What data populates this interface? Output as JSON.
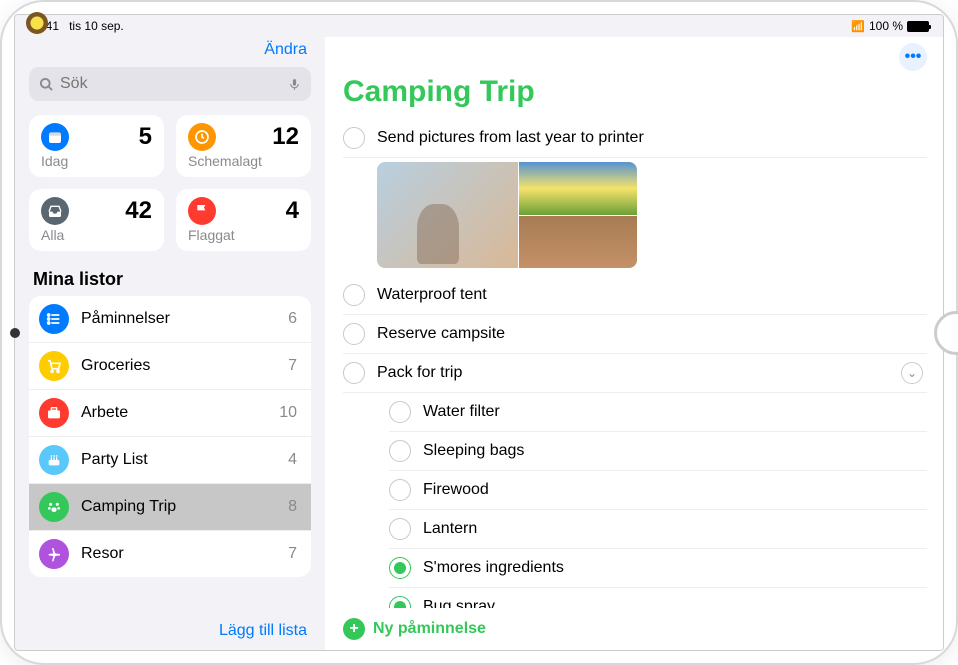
{
  "status": {
    "time": "09:41",
    "date": "tis 10 sep.",
    "battery": "100 %"
  },
  "sidebar": {
    "edit": "Ändra",
    "search_placeholder": "Sök",
    "cards": [
      {
        "id": "today",
        "label": "Idag",
        "count": "5",
        "bg": "#007aff",
        "icon": "calendar"
      },
      {
        "id": "scheduled",
        "label": "Schemalagt",
        "count": "12",
        "bg": "#ff9500",
        "icon": "clock"
      },
      {
        "id": "all",
        "label": "Alla",
        "count": "42",
        "bg": "#5b6770",
        "icon": "inbox"
      },
      {
        "id": "flagged",
        "label": "Flaggat",
        "count": "4",
        "bg": "#ff3b30",
        "icon": "flag"
      }
    ],
    "my_lists_header": "Mina listor",
    "lists": [
      {
        "label": "Påminnelser",
        "count": "6",
        "bg": "#007aff",
        "icon": "list",
        "selected": false
      },
      {
        "label": "Groceries",
        "count": "7",
        "bg": "#ffcc00",
        "icon": "cart",
        "selected": false
      },
      {
        "label": "Arbete",
        "count": "10",
        "bg": "#ff3b30",
        "icon": "briefcase",
        "selected": false
      },
      {
        "label": "Party List",
        "count": "4",
        "bg": "#5ac8fa",
        "icon": "cake",
        "selected": false
      },
      {
        "label": "Camping Trip",
        "count": "8",
        "bg": "#34c759",
        "icon": "paw",
        "selected": true
      },
      {
        "label": "Resor",
        "count": "7",
        "bg": "#af52de",
        "icon": "plane",
        "selected": false
      }
    ],
    "add_list": "Lägg till lista"
  },
  "main": {
    "title": "Camping Trip",
    "accent_color": "#34c759",
    "reminders": [
      {
        "label": "Send pictures from last year to printer",
        "checked": false,
        "sub": false,
        "has_images": true
      },
      {
        "label": "Waterproof tent",
        "checked": false,
        "sub": false
      },
      {
        "label": "Reserve campsite",
        "checked": false,
        "sub": false
      },
      {
        "label": "Pack for trip",
        "checked": false,
        "sub": false,
        "expandable": true
      },
      {
        "label": "Water filter",
        "checked": false,
        "sub": true
      },
      {
        "label": "Sleeping bags",
        "checked": false,
        "sub": true
      },
      {
        "label": "Firewood",
        "checked": false,
        "sub": true
      },
      {
        "label": "Lantern",
        "checked": false,
        "sub": true
      },
      {
        "label": "S'mores ingredients",
        "checked": true,
        "sub": true
      },
      {
        "label": "Bug spray",
        "checked": true,
        "sub": true
      }
    ],
    "new_reminder": "Ny påminnelse"
  }
}
